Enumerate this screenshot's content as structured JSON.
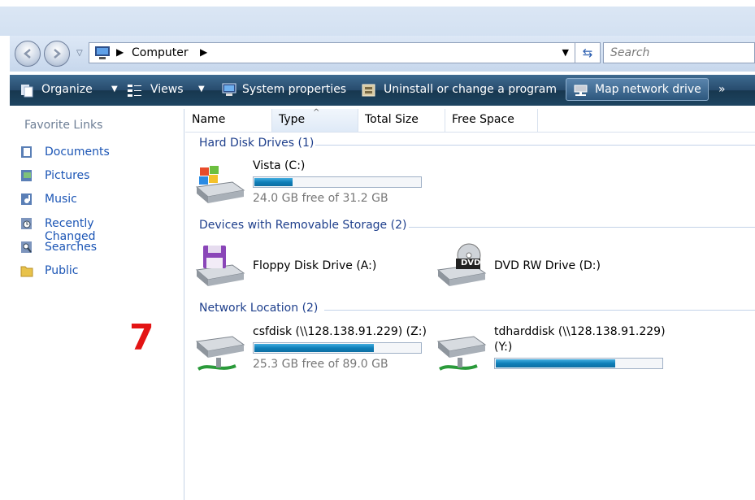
{
  "address": {
    "location": "Computer",
    "search_placeholder": "Search"
  },
  "toolbar": {
    "organize": "Organize",
    "views": "Views",
    "system_properties": "System properties",
    "uninstall": "Uninstall or change a program",
    "map_network": "Map network drive",
    "more": "»"
  },
  "nav": {
    "title": "Favorite Links",
    "items": [
      "Documents",
      "Pictures",
      "Music",
      "Recently Changed",
      "Searches",
      "Public"
    ]
  },
  "annotation_number": "7",
  "columns": [
    "Name",
    "Type",
    "Total Size",
    "Free Space"
  ],
  "groups": {
    "hdd": "Hard Disk Drives (1)",
    "removable": "Devices with Removable Storage (2)",
    "network": "Network Location (2)"
  },
  "drives": {
    "vista": {
      "name": "Vista (C:)",
      "free_text": "24.0 GB free of 31.2 GB",
      "used_fraction": 0.23
    },
    "floppy": {
      "name": "Floppy Disk Drive (A:)"
    },
    "dvd": {
      "name": "DVD RW Drive (D:)",
      "badge": "DVD"
    },
    "csf": {
      "name": "csfdisk (\\\\128.138.91.229) (Z:)",
      "free_text": "25.3 GB free of 89.0 GB",
      "used_fraction": 0.72
    },
    "tdh": {
      "name_line1": "tdharddisk (\\\\128.138.91.229)",
      "name_line2": "(Y:)",
      "used_fraction": 0.72
    }
  },
  "colors": {
    "bar_fill": "#0f7fb9",
    "link": "#1b55b5",
    "annotation": "#e31414",
    "toolbar": "#274b6d"
  }
}
